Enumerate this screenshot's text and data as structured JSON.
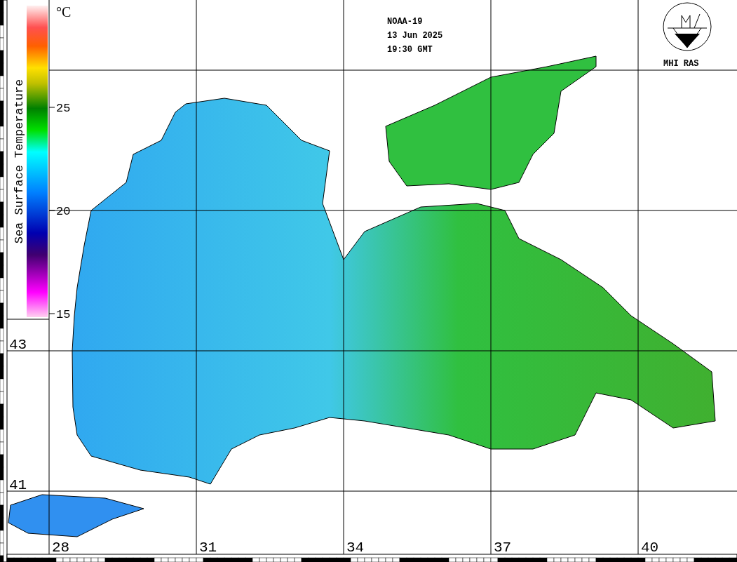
{
  "colorbar": {
    "title": "Sea Surface Temperature",
    "unit": "°C",
    "ticks": [
      "25",
      "20",
      "15"
    ]
  },
  "header": {
    "satellite": "NOAA-19",
    "date": "13 Jun 2025",
    "time": "19:30 GMT"
  },
  "logo": {
    "label": "MHI RAS"
  },
  "latitude_labels": [
    "43",
    "41"
  ],
  "longitude_labels": [
    "28",
    "31",
    "34",
    "37",
    "40"
  ]
}
